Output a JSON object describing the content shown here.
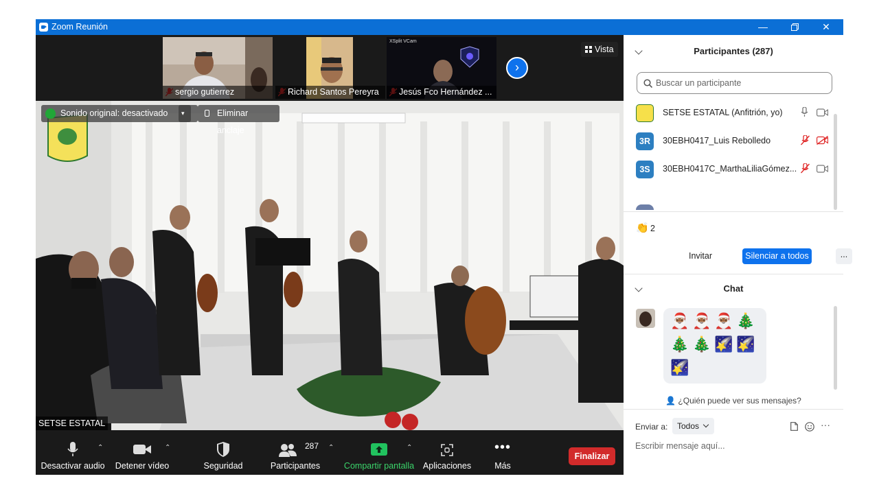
{
  "window": {
    "title": "Zoom Reunión"
  },
  "strip": {
    "participants": [
      {
        "name": "sergio gutierrez"
      },
      {
        "name": "Richard Santos Pereyra"
      },
      {
        "name": "Jesús Fco Hernández ...",
        "overlay_text": "XSplit VCam"
      }
    ],
    "view_label": "Vista"
  },
  "video": {
    "original_sound": "Sonido original: desactivado",
    "unpin": "Eliminar anclaje",
    "speaker": "SETSE ESTATAL"
  },
  "toolbar": {
    "audio": "Desactivar audio",
    "video": "Detener vídeo",
    "security": "Seguridad",
    "participants": "Participantes",
    "participants_count": "287",
    "share": "Compartir pantalla",
    "apps": "Aplicaciones",
    "more": "Más",
    "end": "Finalizar"
  },
  "panel": {
    "participants_header": "Participantes (287)",
    "search_placeholder": "Buscar un participante",
    "participants": [
      {
        "initials": "",
        "name": "SETSE ESTATAL (Anfitrión, yo)",
        "mic": "mic-icon",
        "cam": "camera-icon"
      },
      {
        "initials": "3R",
        "name": "30EBH0417_Luis Rebolledo",
        "mic": "mic-muted-icon",
        "cam": "camera-off-icon",
        "color": "#2d7fc1"
      },
      {
        "initials": "3S",
        "name": "30EBH0417C_MarthaLiliaGómez...",
        "mic": "mic-muted-icon",
        "cam": "camera-icon",
        "color": "#2d7fc1"
      }
    ],
    "reaction_count": "2",
    "invite": "Invitar",
    "mute_all": "Silenciar a todos",
    "more": "...",
    "chat_header": "Chat",
    "chat_emojis": [
      "🎅🏾",
      "🎅🏾",
      "🎅🏾",
      "🎄",
      "🎄",
      "🎄",
      "🌠",
      "🌠",
      "🌠"
    ],
    "who_can_see": "¿Quién puede ver sus mensajes?",
    "send_to_label": "Enviar a:",
    "send_to_value": "Todos",
    "chat_placeholder": "Escribir mensaje aquí..."
  },
  "colors": {
    "titlebar": "#0b6fd6",
    "accent": "#0e72ed",
    "end": "#d22b2b",
    "share": "#21c25e"
  }
}
